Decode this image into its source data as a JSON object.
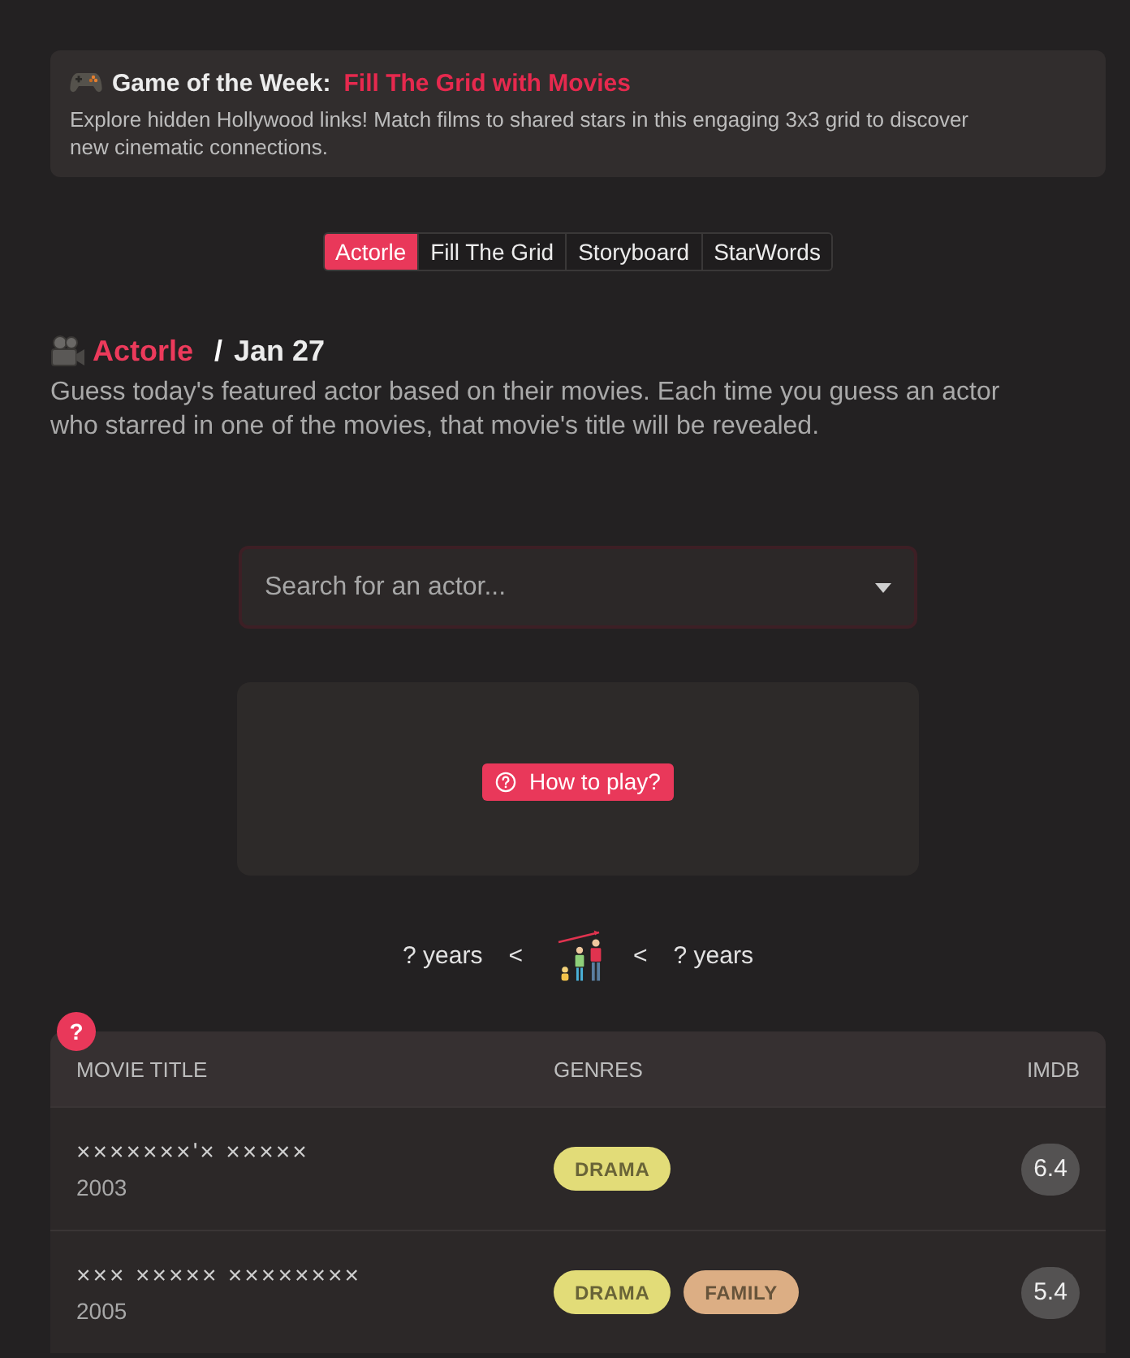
{
  "promo": {
    "label": "Game of the Week:",
    "link": "Fill The Grid with Movies",
    "description": "Explore hidden Hollywood links! Match films to shared stars in this engaging 3x3 grid to discover new cinematic connections."
  },
  "tabs": [
    {
      "label": "Actorle",
      "selected": true
    },
    {
      "label": "Fill The Grid",
      "selected": false
    },
    {
      "label": "Storyboard",
      "selected": false
    },
    {
      "label": "StarWords",
      "selected": false
    }
  ],
  "heading": {
    "title": "Actorle",
    "separator": "/",
    "date": "Jan 27"
  },
  "intro": "Guess today's featured actor based on their movies. Each time you guess an actor who starred in one of the movies, that movie's title will be revealed.",
  "search": {
    "placeholder": "Search for an actor...",
    "focused": true
  },
  "help_button": {
    "label": "How to play?"
  },
  "age_range": {
    "min": "? years",
    "left_sign": "<",
    "right_sign": "<",
    "max": "? years"
  },
  "table": {
    "badge": "?",
    "columns": [
      "MOVIE TITLE",
      "GENRES",
      "IMDB"
    ],
    "rows": [
      {
        "title": "×××××××'× ×××××",
        "year": "2003",
        "genres": [
          {
            "label": "DRAMA",
            "color": "#e2dc78"
          }
        ],
        "rating": "6.4"
      },
      {
        "title": "××× ××××× ××××××××",
        "year": "2005",
        "genres": [
          {
            "label": "DRAMA",
            "color": "#e2dc78"
          },
          {
            "label": "FAMILY",
            "color": "#dcae84"
          }
        ],
        "rating": "5.4"
      }
    ]
  }
}
